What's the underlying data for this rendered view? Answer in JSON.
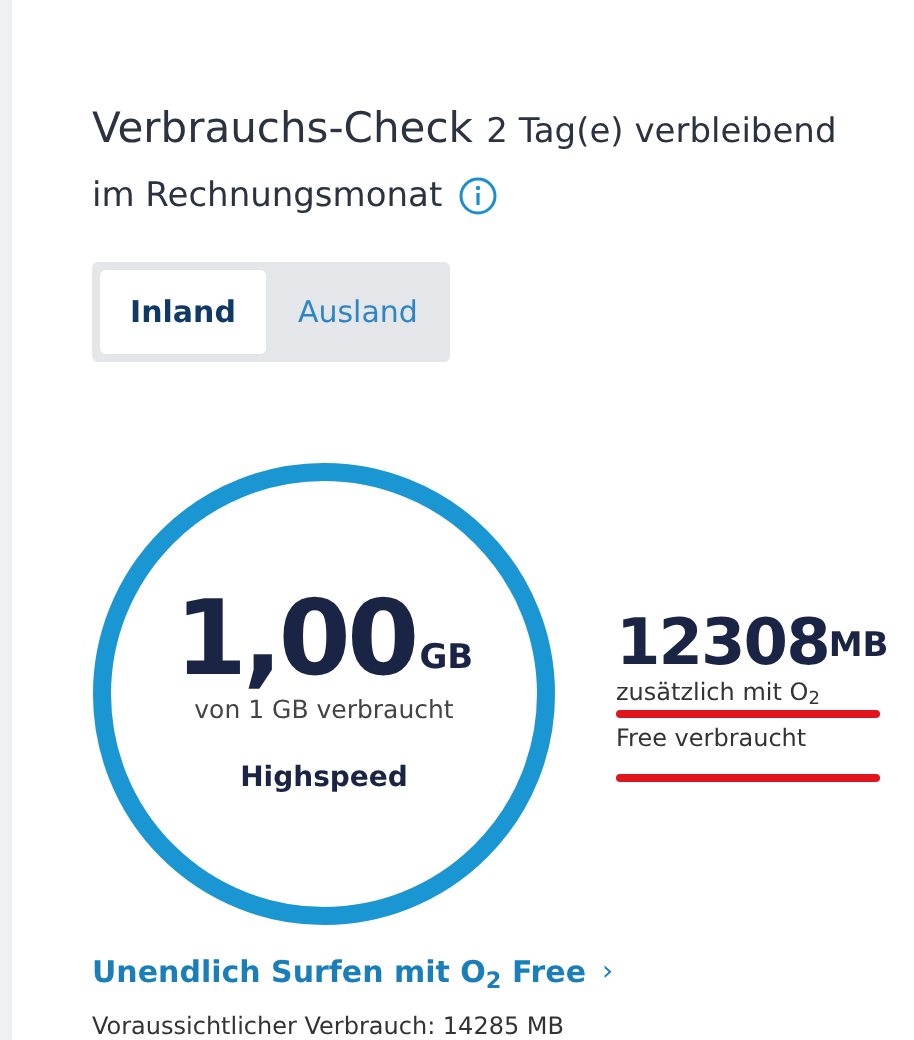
{
  "header": {
    "title": "Verbrauchs-Check",
    "remaining": "2 Tag(e) verbleibend",
    "period": "im Rechnungsmonat"
  },
  "tabs": [
    {
      "label": "Inland",
      "selected": true
    },
    {
      "label": "Ausland",
      "selected": false
    }
  ],
  "usage": {
    "amount": "1,00",
    "unit": "GB",
    "caption": "von 1 GB verbraucht",
    "speed": "Highspeed",
    "level": 1
  },
  "extra": {
    "amount": "12308",
    "unit": "MB",
    "caption": "zusätzlich mit O$_{2}$",
    "caption_2": "Free verbraucht"
  },
  "link": {
    "label": "Unendlich Surfen mit O$_{2}$ Free",
    "arrow": "›"
  },
  "forecast": "Voraussichtlicher Verbrauch: 14285 MB"
}
